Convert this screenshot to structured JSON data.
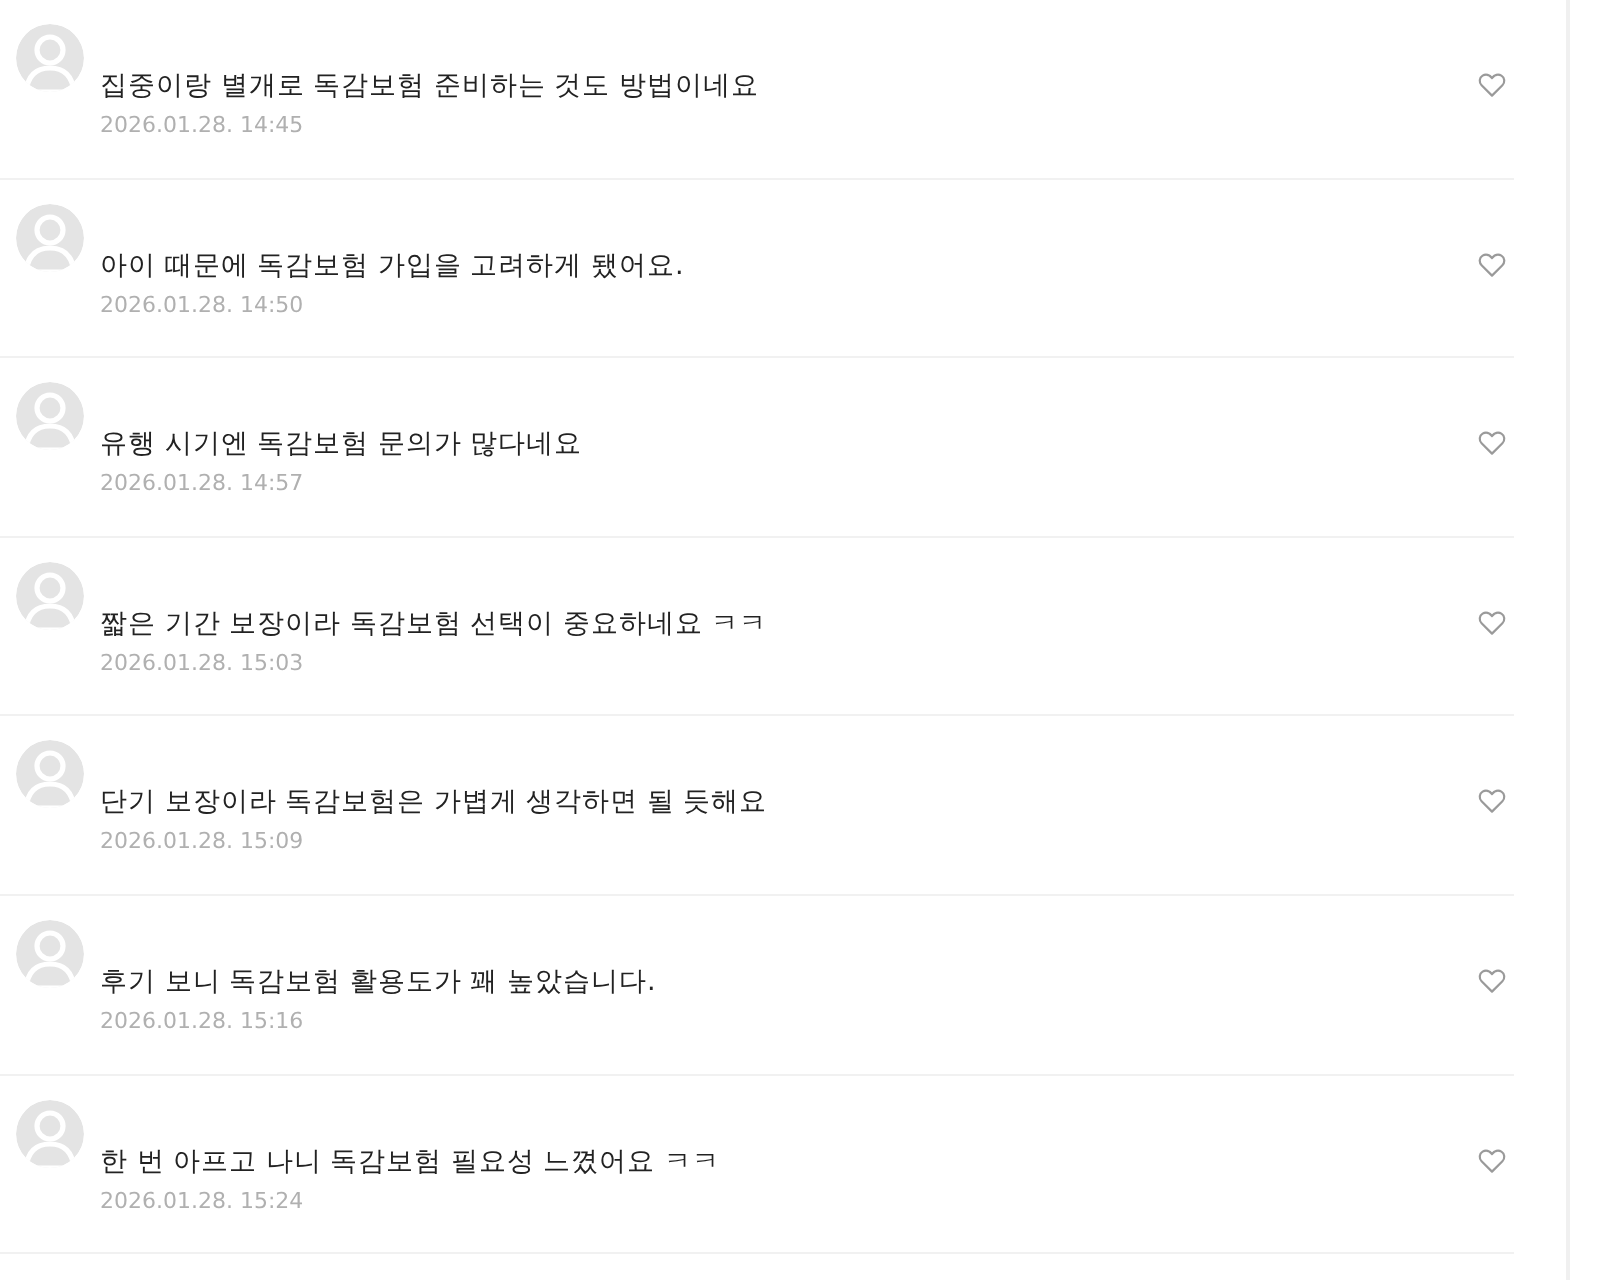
{
  "comments": [
    {
      "text": "집중이랑 별개로 독감보험 준비하는 것도 방법이네요",
      "date": "2026.01.28. 14:45"
    },
    {
      "text": "아이 때문에 독감보험 가입을 고려하게 됐어요.",
      "date": "2026.01.28. 14:50"
    },
    {
      "text": "유행 시기엔 독감보험 문의가 많다네요",
      "date": "2026.01.28. 14:57"
    },
    {
      "text": "짧은 기간 보장이라 독감보험 선택이 중요하네요 ㅋㅋ",
      "date": "2026.01.28. 15:03"
    },
    {
      "text": "단기 보장이라 독감보험은 가볍게 생각하면 될 듯해요",
      "date": "2026.01.28. 15:09"
    },
    {
      "text": "후기 보니 독감보험 활용도가 꽤 높았습니다.",
      "date": "2026.01.28. 15:16"
    },
    {
      "text": "한 번 아프고 나니 독감보험 필요성 느꼈어요 ㅋㅋ",
      "date": "2026.01.28. 15:24"
    }
  ]
}
